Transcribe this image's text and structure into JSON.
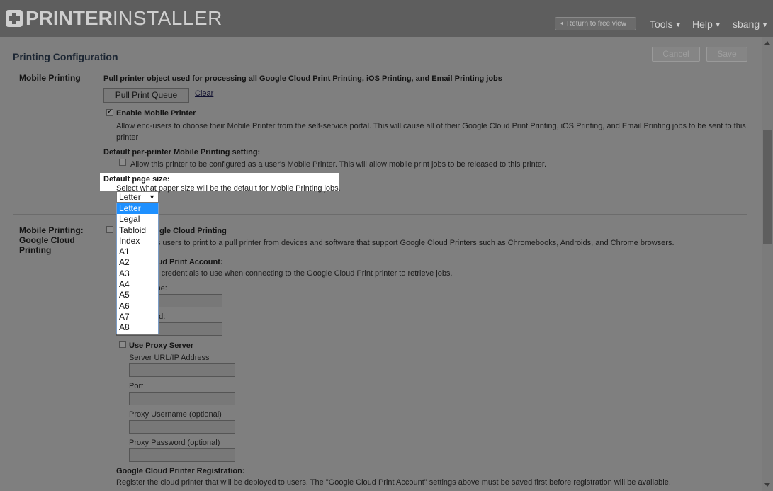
{
  "header": {
    "logo_bold": "PRINTER",
    "logo_thin": "INSTALLER",
    "return_label": "Return to free view",
    "menus": [
      {
        "label": "Tools"
      },
      {
        "label": "Help"
      },
      {
        "label": "sbang"
      }
    ]
  },
  "page": {
    "title": "Printing Configuration",
    "cancel_label": "Cancel",
    "save_label": "Save"
  },
  "mobile": {
    "label": "Mobile Printing",
    "pull_desc": "Pull printer object used for processing all Google Cloud Print Printing, iOS Printing, and Email Printing jobs",
    "pull_button": "Pull Print Queue",
    "clear_link": "Clear",
    "enable_label": "Enable Mobile Printer",
    "enable_checked": true,
    "enable_desc_1": "Allow end-users to choose their Mobile Printer from the self-service portal. This will cause all of their Google Cloud Print Printing, iOS Printing, and Email Printing jobs to be sent to this",
    "enable_desc_2": "printer",
    "default_setting_label": "Default per-printer Mobile Printing setting:",
    "allow_desc": "Allow this printer to be configured as a user's Mobile Printer. This will allow mobile print jobs to be released to this printer.",
    "page_size_label": "Default page size:",
    "page_size_desc": "Select what paper size will be the default for Mobile Printing jobs.",
    "page_size_value": "Letter",
    "page_size_options": [
      "Letter",
      "Legal",
      "Tabloid",
      "Index",
      "A1",
      "A2",
      "A3",
      "A4",
      "A5",
      "A6",
      "A7",
      "A8"
    ]
  },
  "gcp": {
    "label_1": "Mobile Printing:",
    "label_2": "Google Cloud",
    "label_3": "Printing",
    "enable_label": "Enable Google Cloud Printing",
    "enable_desc": "This enables users to print to a pull printer from devices and software that support Google Cloud Printers such as Chromebooks, Androids, and Chrome browsers.",
    "account_label": "Google Cloud Print Account:",
    "account_desc": "The account credentials to use when connecting to the Google Cloud Print printer to retrieve jobs.",
    "username_label": "Username:",
    "password_label": "Password:",
    "proxy_label": "Use Proxy Server",
    "server_label": "Server URL/IP Address",
    "port_label": "Port",
    "proxy_user_label": "Proxy Username (optional)",
    "proxy_pass_label": "Proxy Password (optional)",
    "registration_label": "Google Cloud Printer Registration:",
    "registration_desc": "Register the cloud printer that will be deployed to users. The \"Google Cloud Print Account\" settings above must be saved first before registration will be available."
  }
}
